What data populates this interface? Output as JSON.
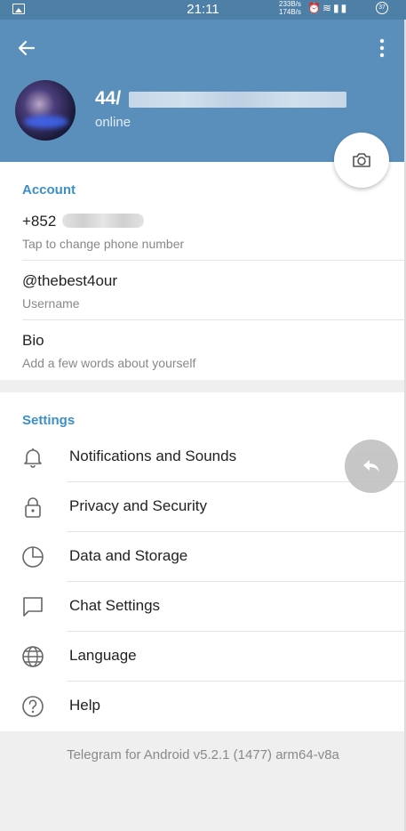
{
  "status_bar": {
    "time": "21:11",
    "rate_up": "233B/s",
    "rate_down": "174B/s",
    "battery": "37"
  },
  "header": {
    "back_icon": "arrow-left-icon",
    "menu_icon": "more-vertical-icon",
    "title": "44/",
    "status": "online"
  },
  "account": {
    "section_title": "Account",
    "phone": "+852",
    "phone_hint": "Tap to change phone number",
    "username": "@thebest4our",
    "username_hint": "Username",
    "bio": "Bio",
    "bio_hint": "Add a few words about yourself"
  },
  "settings": {
    "section_title": "Settings",
    "items": [
      {
        "label": "Notifications and Sounds",
        "icon": "bell-icon"
      },
      {
        "label": "Privacy and Security",
        "icon": "lock-icon"
      },
      {
        "label": "Data and Storage",
        "icon": "pie-chart-icon"
      },
      {
        "label": "Chat Settings",
        "icon": "chat-bubble-icon"
      },
      {
        "label": "Language",
        "icon": "globe-icon"
      },
      {
        "label": "Help",
        "icon": "help-circle-icon"
      }
    ]
  },
  "footer": {
    "version": "Telegram for Android v5.2.1 (1477) arm64-v8a"
  },
  "colors": {
    "header_bg": "#5a8fbb",
    "accent": "#3b8fc8"
  }
}
